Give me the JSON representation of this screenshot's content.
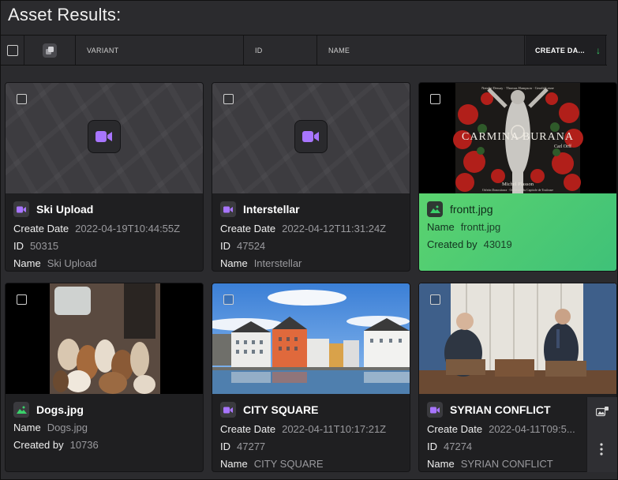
{
  "page": {
    "title": "Asset Results:"
  },
  "table_header": {
    "columns": [
      "VARIANT",
      "ID",
      "NAME",
      "CREATE DA..."
    ],
    "sort_indicator": "↓"
  },
  "cards": [
    {
      "title": "Ski Upload",
      "type": "video",
      "selected": false,
      "rows": [
        {
          "label": "Create Date",
          "value": "2022-04-19T10:44:55Z"
        },
        {
          "label": "ID",
          "value": "50315"
        },
        {
          "label": "Name",
          "value": "Ski Upload"
        }
      ]
    },
    {
      "title": "Interstellar",
      "type": "video",
      "selected": false,
      "rows": [
        {
          "label": "Create Date",
          "value": "2022-04-12T11:31:24Z"
        },
        {
          "label": "ID",
          "value": "47524"
        },
        {
          "label": "Name",
          "value": "Interstellar"
        }
      ]
    },
    {
      "title": "frontt.jpg",
      "type": "image",
      "selected": true,
      "rows": [
        {
          "label": "Name",
          "value": "frontt.jpg"
        },
        {
          "label": "Created by",
          "value": "43019"
        }
      ]
    },
    {
      "title": "Dogs.jpg",
      "type": "image",
      "selected": false,
      "rows": [
        {
          "label": "Name",
          "value": "Dogs.jpg"
        },
        {
          "label": "Created by",
          "value": "10736"
        }
      ]
    },
    {
      "title": "CITY SQUARE",
      "type": "video",
      "selected": false,
      "rows": [
        {
          "label": "Create Date",
          "value": "2022-04-11T10:17:21Z"
        },
        {
          "label": "ID",
          "value": "47277"
        },
        {
          "label": "Name",
          "value": "CITY SQUARE"
        }
      ]
    },
    {
      "title": "SYRIAN CONFLICT",
      "type": "video",
      "selected": false,
      "rows": [
        {
          "label": "Create Date",
          "value": "2022-04-11T09:5..."
        },
        {
          "label": "ID",
          "value": "47274"
        },
        {
          "label": "Name",
          "value": "SYRIAN CONFLICT"
        }
      ]
    }
  ],
  "poster_text": {
    "top_line": "Natalie Dessay · Thomas Hampson · Gerald Lesne",
    "title": "CARMINA BURANA",
    "composer": "Carl Orff",
    "conductor": "Michel Plasson",
    "bottom_line": "Orfeón Donostiarra · Orchestre du Capitole de Toulouse"
  },
  "colors": {
    "video_accent": "#a875ff",
    "image_accent": "#3ad16b",
    "selected_bg": "#4fcb74",
    "sort_arrow": "#3ad16b"
  },
  "icons": {
    "header_group": "stack-icon",
    "video": "video-camera-icon",
    "image": "image-icon",
    "side_tool_1": "add-image-icon",
    "side_tool_2": "more-vertical-icon"
  }
}
